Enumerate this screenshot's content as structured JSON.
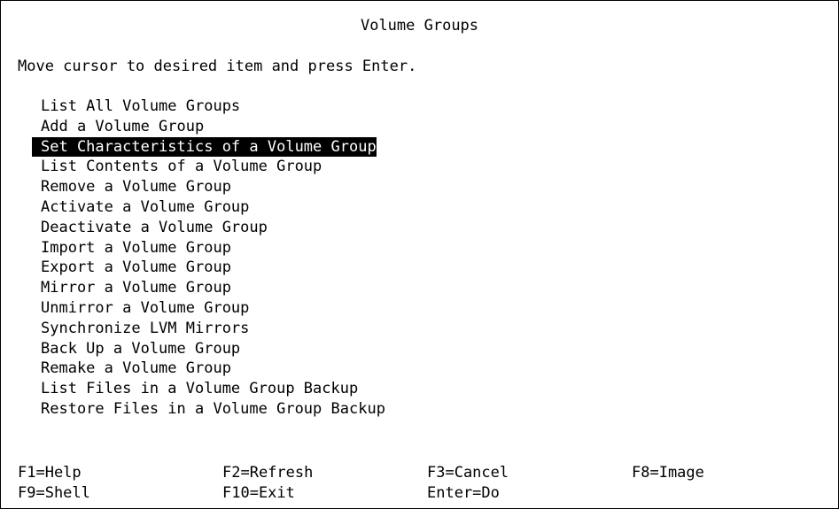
{
  "window": {
    "title": "Volume Groups"
  },
  "instruction": "Move cursor to desired item and press Enter.",
  "menu": {
    "selected_index": 2,
    "items": [
      "List All Volume Groups",
      "Add a Volume Group",
      "Set Characteristics of a Volume Group",
      "List Contents of a Volume Group",
      "Remove a Volume Group",
      "Activate a Volume Group",
      "Deactivate a Volume Group",
      "Import a Volume Group",
      "Export a Volume Group",
      "Mirror a Volume Group",
      "Unmirror a Volume Group",
      "Synchronize LVM Mirrors",
      "Back Up a Volume Group",
      "Remake a Volume Group",
      "List Files in a Volume Group Backup",
      "Restore Files in a Volume Group Backup"
    ]
  },
  "function_keys": {
    "row1": [
      "F1=Help",
      "F2=Refresh",
      "F3=Cancel",
      "F8=Image"
    ],
    "row2": [
      "F9=Shell",
      "F10=Exit",
      "Enter=Do"
    ]
  },
  "colors": {
    "background": "#ffffff",
    "text": "#000000",
    "highlight_bg": "#000000",
    "highlight_text": "#ffffff"
  }
}
